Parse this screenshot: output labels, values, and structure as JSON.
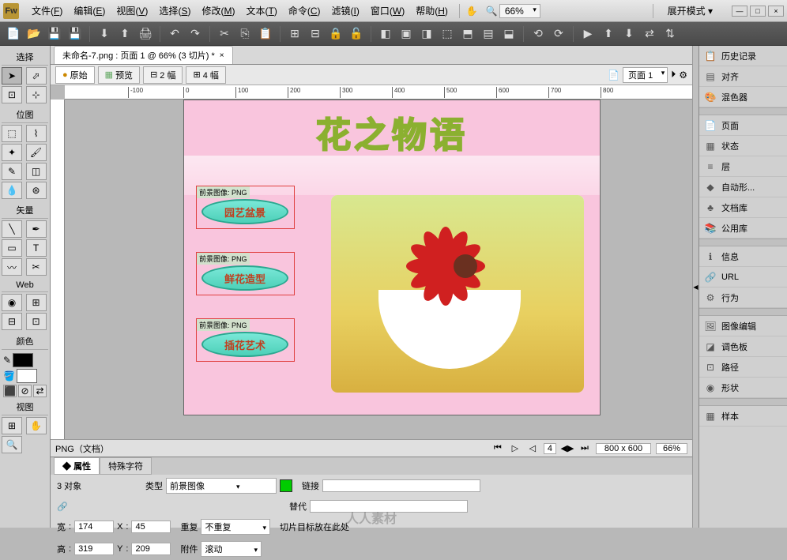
{
  "app": {
    "logo": "Fw"
  },
  "menubar": {
    "items": [
      {
        "label": "文件",
        "hotkey": "F"
      },
      {
        "label": "编辑",
        "hotkey": "E"
      },
      {
        "label": "视图",
        "hotkey": "V"
      },
      {
        "label": "选择",
        "hotkey": "S"
      },
      {
        "label": "修改",
        "hotkey": "M"
      },
      {
        "label": "文本",
        "hotkey": "T"
      },
      {
        "label": "命令",
        "hotkey": "C"
      },
      {
        "label": "滤镜",
        "hotkey": "I"
      },
      {
        "label": "窗口",
        "hotkey": "W"
      },
      {
        "label": "帮助",
        "hotkey": "H"
      }
    ],
    "zoom": "66%",
    "mode": "展开模式"
  },
  "tools": {
    "sections": {
      "select": "选择",
      "bitmap": "位图",
      "vector": "矢量",
      "web": "Web",
      "color": "颜色",
      "view": "视图"
    }
  },
  "document": {
    "tab_title": "未命名-7.png : 页面 1 @ 66% (3 切片) *",
    "view_tabs": {
      "original": "原始",
      "preview": "预览",
      "two_up": "2 幅",
      "four_up": "4 幅"
    },
    "page_label": "页面 1"
  },
  "canvas": {
    "title_text": "花之物语",
    "nav1": "园艺盆景",
    "nav2": "鲜花造型",
    "nav3": "插花艺术",
    "slice_label": "前景图像: PNG"
  },
  "status": {
    "doc_type": "PNG（文档）",
    "frame": "4",
    "dims": "800 x 600",
    "zoom": "66%"
  },
  "props": {
    "tabs": {
      "properties": "属性",
      "special": "特殊字符"
    },
    "object_count": "3 对象",
    "type_label": "类型",
    "type_value": "前景图像",
    "link_label": "链接",
    "alt_label": "替代",
    "width_label": "宽",
    "width_value": "174",
    "x_label": "X",
    "x_value": "45",
    "height_label": "高",
    "height_value": "319",
    "y_label": "Y",
    "y_value": "209",
    "repeat_label": "重复",
    "repeat_value": "不重复",
    "attach_label": "附件",
    "attach_value": "滚动",
    "slice_target": "切片目标放在此处",
    "watermark": "人人素材"
  },
  "panels": {
    "items": [
      "历史记录",
      "对齐",
      "混色器",
      "页面",
      "状态",
      "层",
      "自动形...",
      "文档库",
      "公用库",
      "信息",
      "URL",
      "行为",
      "图像编辑",
      "调色板",
      "路径",
      "形状",
      "样本"
    ]
  }
}
